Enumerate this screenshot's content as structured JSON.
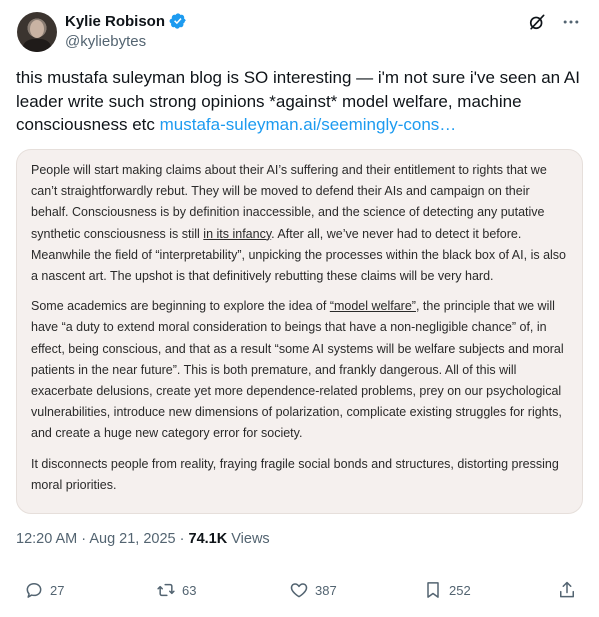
{
  "author": {
    "name": "Kylie Robison",
    "handle": "@kyliebytes"
  },
  "tweet": {
    "text": "this mustafa suleyman blog is SO interesting — i'm not sure i've seen an AI leader write such strong opinions *against* model welfare, machine consciousness etc ",
    "link": "mustafa-suleyman.ai/seemingly-cons…"
  },
  "quote": {
    "p1_a": "People will start making claims about their AI’s suffering and their entitlement to rights that we can’t straightforwardly rebut. They will be moved to defend their AIs and campaign on their behalf. Consciousness is by definition inaccessible, and the science of detecting any putative synthetic consciousness is still ",
    "p1_u": "in its infancy",
    "p1_b": ". After all, we’ve never had to detect it before. Meanwhile the field of “interpretability”, unpicking the processes within the black box of AI, is also a nascent art. The upshot is that definitively rebutting these claims will be very hard.",
    "p2_a": "Some academics are beginning to explore the idea of ",
    "p2_u": "“model welfare”",
    "p2_b": ", the principle that we will have “a duty to extend moral consideration to beings that have a non-negligible chance” of, in effect, being conscious, and that as a result “some AI systems will be welfare subjects and moral patients in the near future”. This is both premature, and frankly dangerous. All of this will exacerbate delusions, create yet more dependence-related problems, prey on our psychological vulnerabilities, introduce new dimensions of polarization, complicate existing struggles for rights, and create a huge new category error for society.",
    "p3": "It disconnects people from reality, fraying fragile social bonds and structures, distorting pressing moral priorities."
  },
  "meta": {
    "time_date": "12:20 AM · Aug 21, 2025 · ",
    "views_count": "74.1K",
    "views_label": " Views"
  },
  "actions": {
    "replies": "27",
    "reposts": "63",
    "likes": "387",
    "bookmarks": "252"
  },
  "icons": {
    "verified": "verified-badge-icon",
    "grok": "grok-icon",
    "more": "more-icon",
    "reply": "reply-icon",
    "repost": "repost-icon",
    "like": "heart-icon",
    "bookmark": "bookmark-icon",
    "share": "share-icon"
  },
  "colors": {
    "link": "#1d9bf0",
    "verified": "#1d9bf0",
    "secondary_text": "#536471",
    "quote_bg": "#f5f0ee"
  }
}
